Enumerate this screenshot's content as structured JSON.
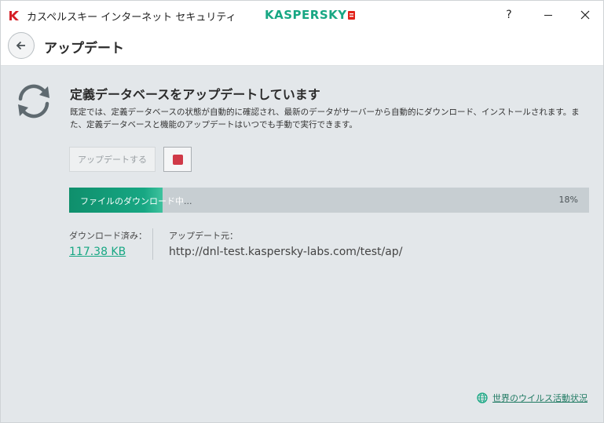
{
  "window": {
    "title": "カスペルスキー インターネット セキュリティ",
    "brand": "KASPERSKY",
    "help_label": "?"
  },
  "header": {
    "title": "アップデート"
  },
  "main": {
    "heading": "定義データベースをアップデートしています",
    "description": "既定では、定義データベースの状態が自動的に確認され、最新のデータがサーバーから自動的にダウンロード、インストールされます。また、定義データベースと機能のアップデートはいつでも手動で実行できます。",
    "update_button_label": "アップデートする",
    "progress": {
      "label": "ファイルのダウンロード中",
      "label_tail": "...",
      "percent_text": "18%",
      "fraction": 0.18
    },
    "downloaded_label": "ダウンロード済み：",
    "downloaded_value": "117.38 KB",
    "source_label": "アップデート元：",
    "source_value": "http://dnl-test.kaspersky-labs.com/test/ap/"
  },
  "footer": {
    "threat_link": "世界のウイルス活動状況"
  },
  "colors": {
    "accent": "#17a783",
    "stop": "#d03a48",
    "background": "#e3e7ea"
  },
  "icons": {
    "app": "kaspersky-k-icon",
    "back": "arrow-left-icon",
    "update": "sync-icon",
    "stop": "stop-icon",
    "globe": "globe-icon",
    "minimize": "minimize-icon",
    "close": "close-icon"
  }
}
